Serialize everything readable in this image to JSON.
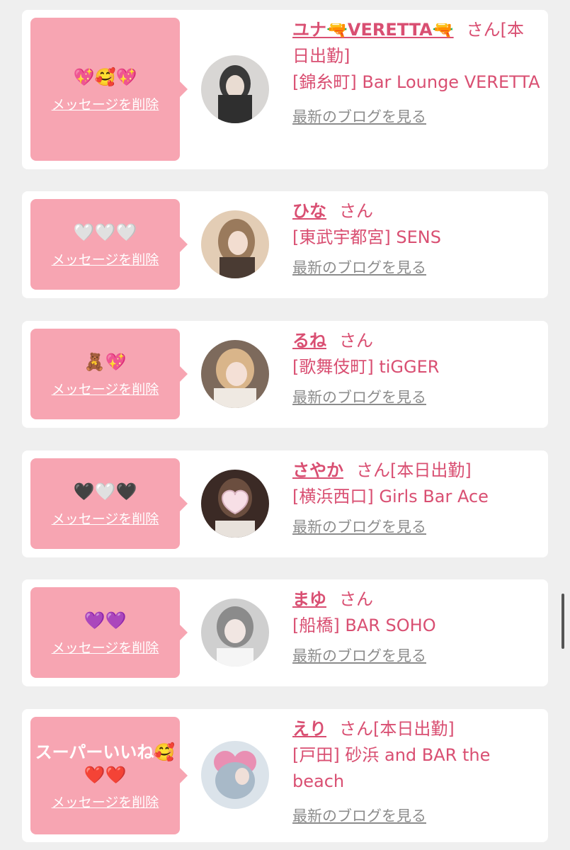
{
  "colors": {
    "accent": "#d94f72",
    "bubble": "#f7a5b2",
    "link_gray": "#8c8c8c",
    "page_bg": "#efefef"
  },
  "delete_label": "メッセージを削除",
  "blog_label": "最新のブログを見る",
  "entries": [
    {
      "message": "💖🥰💖",
      "name": "ユナ🔫VERETTA🔫",
      "suffix": "さん[本日出勤]",
      "location": "[錦糸町] Bar Lounge VERETTA"
    },
    {
      "message": "🤍🤍🤍",
      "name": "ひな",
      "suffix": "さん",
      "location": "[東武宇都宮] SENS"
    },
    {
      "message": "🧸💖",
      "name": "るね",
      "suffix": "さん",
      "location": "[歌舞伎町] tiGGER"
    },
    {
      "message": "🖤🤍🖤",
      "name": "さやか",
      "suffix": "さん[本日出勤]",
      "location": "[横浜西口] Girls Bar Ace"
    },
    {
      "message": "💜💜",
      "name": "まゆ",
      "suffix": "さん",
      "location": "[船橋] BAR SOHO"
    },
    {
      "message": "スーパーいいね🥰",
      "message2": "❤️❤️",
      "name": "えり",
      "suffix": "さん[本日出勤]",
      "location": "[戸田] 砂浜 and BAR the beach"
    }
  ]
}
